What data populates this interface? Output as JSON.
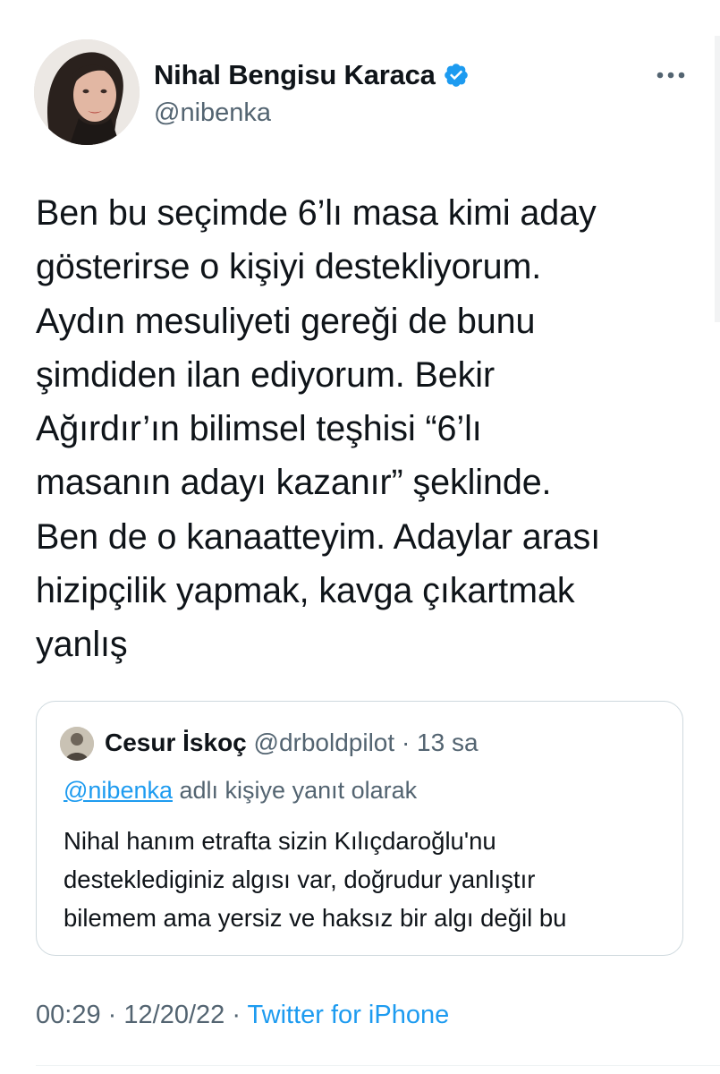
{
  "author": {
    "name": "Nihal Bengisu Karaca",
    "handle": "@nibenka",
    "verified": true
  },
  "tweet": {
    "lines": [
      "Ben bu seçimde 6’lı masa kimi aday",
      "gösterirse o kişiyi destekliyorum.",
      "Aydın mesuliyeti gereği de bunu",
      "şimdiden ilan ediyorum. Bekir",
      "Ağırdır’ın bilimsel teşhisi “6’lı",
      "masanın adayı kazanır” şeklinde.",
      "Ben de o kanaatteyim. Adaylar arası",
      "hizipçilik yapmak, kavga çıkartmak",
      "yanlış"
    ]
  },
  "quoted": {
    "name": "Cesur İskoç",
    "handle": "@drboldpilot",
    "separator": "·",
    "time": "13 sa",
    "reply_mention": "@nibenka",
    "reply_suffix": "adlı kişiye yanıt olarak",
    "lines": [
      "Nihal hanım etrafta sizin Kılıçdaroğlu'nu",
      "desteklediginiz algısı var, doğrudur yanlıştır",
      "bilemem ama yersiz ve haksız bir algı değil bu"
    ]
  },
  "meta": {
    "time": "00:29",
    "separator": "·",
    "date": "12/20/22",
    "source": "Twitter for iPhone"
  },
  "colors": {
    "accent": "#1d9bf0",
    "secondary_text": "#536471",
    "border": "#cfd9de"
  },
  "icons": {
    "verified": "verified-badge-icon",
    "more": "more-options-icon"
  }
}
